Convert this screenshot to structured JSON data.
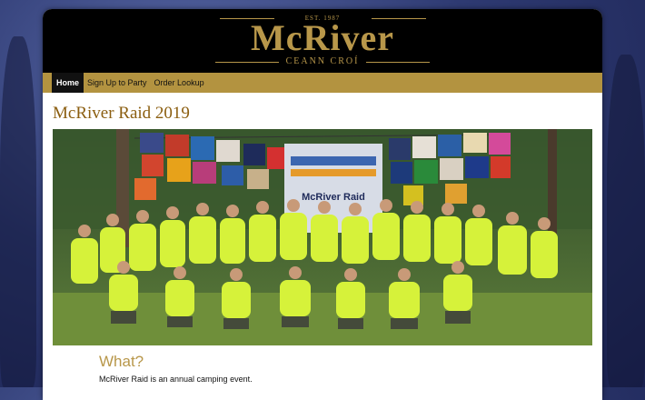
{
  "logo": {
    "established": "EST. 1987",
    "name": "McRiver",
    "tagline": "CEANN CROÍ"
  },
  "nav": {
    "items": [
      {
        "label": "Home",
        "active": true
      },
      {
        "label": "Sign Up to Party",
        "active": false
      },
      {
        "label": "Order Lookup",
        "active": false
      }
    ]
  },
  "main": {
    "title": "McRiver Raid 2019",
    "section_heading": "What?",
    "section_text": "McRiver Raid is an annual camping event."
  },
  "photo": {
    "banner_text": "McRiver Raid"
  },
  "colors": {
    "gold": "#b8974a",
    "nav_bar": "#b39340",
    "title_brown": "#8b5e10",
    "shirt_neon": "#d6f23a"
  }
}
